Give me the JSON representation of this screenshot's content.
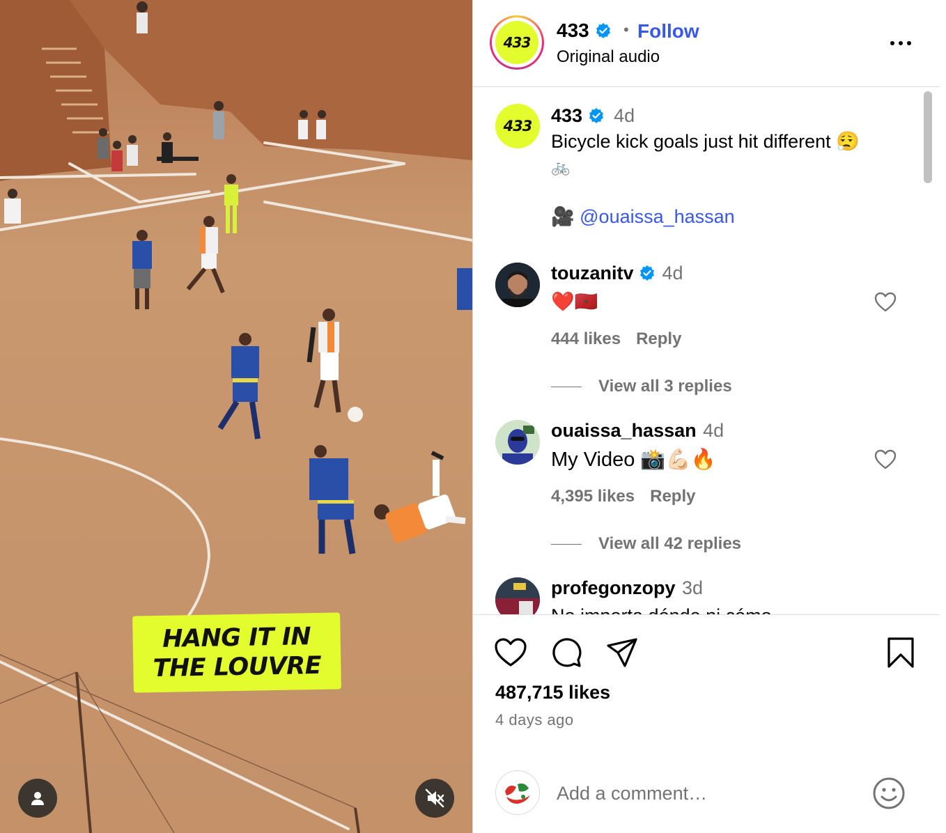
{
  "video": {
    "caption_line1": "HANG IT IN",
    "caption_line2": "THE LOUVRE"
  },
  "post_header": {
    "account_name": "433",
    "logo_text": "433",
    "separator": "•",
    "follow_label": "Follow",
    "audio_label": "Original audio"
  },
  "caption": {
    "username": "433",
    "time": "4d",
    "text": "Bicycle kick goals just hit different 😮‍💨",
    "bike_emoji": "🚲",
    "camera_emoji": "🎥",
    "mention": "@ouaissa_hassan"
  },
  "comments": [
    {
      "username": "touzanitv",
      "verified": true,
      "time": "4d",
      "text": "❤️🇲🇦",
      "likes": "444 likes",
      "reply_label": "Reply",
      "view_replies": "View all 3 replies"
    },
    {
      "username": "ouaissa_hassan",
      "verified": false,
      "time": "4d",
      "text": "My Video 📸💪🏻🔥",
      "likes": "4,395 likes",
      "reply_label": "Reply",
      "view_replies": "View all 42 replies"
    },
    {
      "username": "profegonzopy",
      "verified": false,
      "time": "3d",
      "text": "No importa dónde ni cómo"
    }
  ],
  "actions": {
    "like_icon": "heart-icon",
    "comment_icon": "comment-icon",
    "share_icon": "paper-plane-icon",
    "save_icon": "bookmark-icon"
  },
  "stats": {
    "likes": "487,715 likes",
    "date": "4 days ago"
  },
  "add_comment": {
    "placeholder": "Add a comment…"
  },
  "colors": {
    "brand_yellow": "#e3fc2e",
    "link_blue": "#3858e9",
    "verified_blue": "#0095f6",
    "muted_gray": "#737373"
  }
}
